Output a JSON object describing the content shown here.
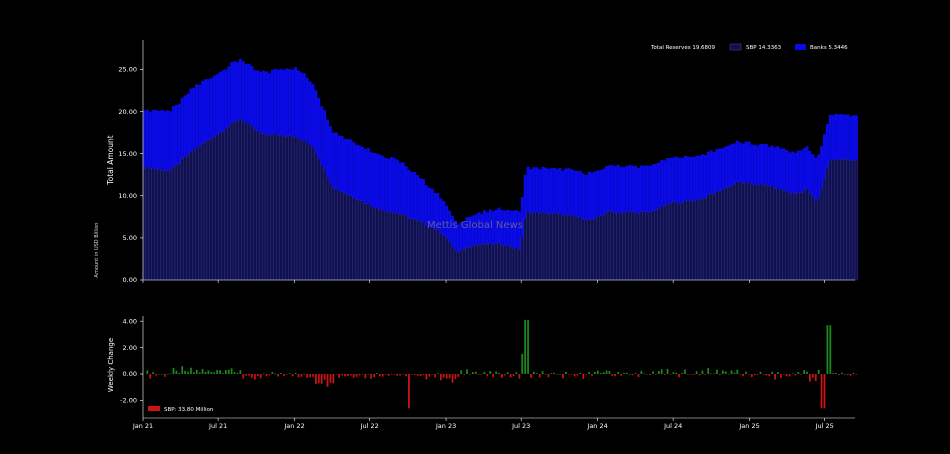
{
  "watermark": "Mettis Global News",
  "unit_note": "Amount in USD Billion",
  "chart_data": [
    {
      "type": "bar",
      "stacked": true,
      "ylabel": "Total Amount",
      "ylim": [
        0,
        28.5
      ],
      "yticks": [
        0,
        5,
        10,
        15,
        20,
        25
      ],
      "ytick_labels": [
        "0.00",
        "5.00",
        "10.00",
        "15.00",
        "20.00",
        "25.00"
      ],
      "legend": {
        "placement": "top-right",
        "entries": [
          "Total Reserves 19.6809",
          "SBP 14.3363",
          "Banks 5.3446"
        ]
      },
      "colors": {
        "sbp": "#10104a",
        "sbp_edge": "#3a3aa8",
        "banks": "#0a0ae6"
      },
      "x_start": "2021-01-01",
      "x_end": "2025-09-12",
      "step_days": 7,
      "series_keypoints": {
        "sbp": [
          [
            "2021-01-01",
            13.4
          ],
          [
            "2021-03-05",
            13.0
          ],
          [
            "2021-05-01",
            15.5
          ],
          [
            "2021-07-01",
            17.5
          ],
          [
            "2021-08-20",
            19.2
          ],
          [
            "2021-10-10",
            17.3
          ],
          [
            "2021-12-20",
            17.2
          ],
          [
            "2022-02-10",
            16.0
          ],
          [
            "2022-04-01",
            11.0
          ],
          [
            "2022-06-01",
            9.6
          ],
          [
            "2022-07-15",
            8.5
          ],
          [
            "2022-09-01",
            8.0
          ],
          [
            "2022-11-10",
            6.6
          ],
          [
            "2022-12-20",
            5.6
          ],
          [
            "2023-01-25",
            3.2
          ],
          [
            "2023-03-01",
            4.2
          ],
          [
            "2023-05-15",
            4.3
          ],
          [
            "2023-06-25",
            3.6
          ],
          [
            "2023-07-10",
            8.1
          ],
          [
            "2023-10-01",
            7.8
          ],
          [
            "2023-12-20",
            7.1
          ],
          [
            "2024-01-20",
            8.1
          ],
          [
            "2024-05-01",
            8.0
          ],
          [
            "2024-06-20",
            9.1
          ],
          [
            "2024-09-01",
            9.6
          ],
          [
            "2024-12-01",
            11.6
          ],
          [
            "2025-02-15",
            11.2
          ],
          [
            "2025-04-15",
            10.2
          ],
          [
            "2025-05-15",
            10.8
          ],
          [
            "2025-06-10",
            9.2
          ],
          [
            "2025-07-10",
            14.3
          ],
          [
            "2025-09-12",
            14.3
          ]
        ],
        "banks": [
          [
            "2021-01-01",
            6.8
          ],
          [
            "2021-05-01",
            7.4
          ],
          [
            "2021-09-15",
            7.0
          ],
          [
            "2022-01-01",
            8.2
          ],
          [
            "2022-04-01",
            6.6
          ],
          [
            "2022-09-01",
            6.4
          ],
          [
            "2023-01-25",
            3.3
          ],
          [
            "2023-06-25",
            4.5
          ],
          [
            "2023-07-10",
            5.3
          ],
          [
            "2024-01-01",
            5.5
          ],
          [
            "2024-06-01",
            5.5
          ],
          [
            "2025-01-01",
            4.7
          ],
          [
            "2025-06-10",
            5.0
          ],
          [
            "2025-07-10",
            5.3
          ],
          [
            "2025-09-12",
            5.3
          ]
        ]
      }
    },
    {
      "type": "bar",
      "ylabel": "Weekly Change",
      "ylim": [
        -2.9,
        4.4
      ],
      "yticks": [
        -2,
        0,
        2,
        4
      ],
      "ytick_labels": [
        "-2.00",
        "0.00",
        "2.00",
        "4.00"
      ],
      "xtick_dates": [
        "2021-01-01",
        "2021-07-01",
        "2022-01-01",
        "2022-07-01",
        "2023-01-01",
        "2023-07-01",
        "2024-01-01",
        "2024-07-01",
        "2025-01-01",
        "2025-07-01"
      ],
      "xtick_labels": [
        "Jan 21",
        "Jul 21",
        "Jan 22",
        "Jul 22",
        "Jan 23",
        "Jul 23",
        "Jan 24",
        "Jul 24",
        "Jan 25",
        "Jul 25"
      ],
      "legend": {
        "placement": "bottom-left",
        "entries": [
          "SBP: 33.80 Million"
        ]
      },
      "colors": {
        "positive": "#1c8a1c",
        "negative": "#cc1414"
      }
    }
  ]
}
